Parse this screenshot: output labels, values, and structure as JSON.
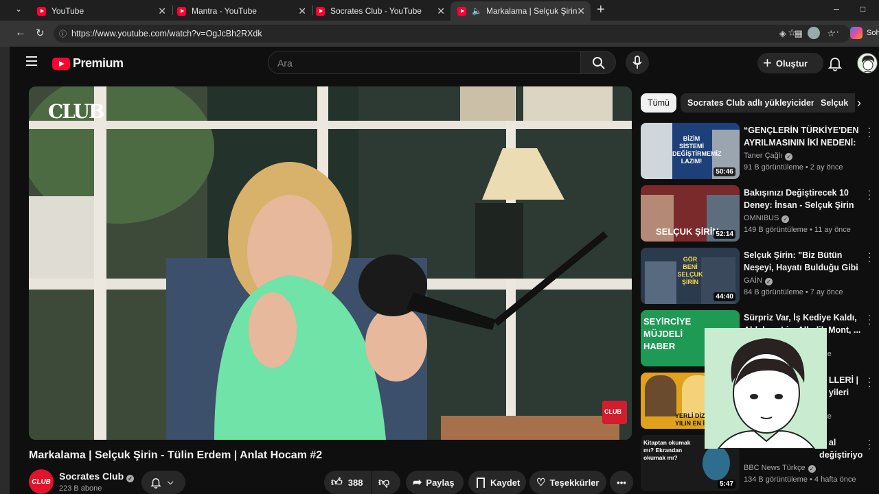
{
  "browser": {
    "tabs": [
      {
        "title": "YouTube",
        "active": false
      },
      {
        "title": "Mantra - YouTube",
        "active": false
      },
      {
        "title": "Socrates Club - YouTube",
        "active": false
      },
      {
        "title": "Markalama | Selçuk Şirin - Tülin",
        "active": true
      }
    ],
    "url": "https://www.youtube.com/watch?v=OgJcBh2RXdk",
    "copilot_label": "Soh"
  },
  "header": {
    "logo_text": "Premium",
    "search_placeholder": "Ara",
    "create_label": "Oluştur"
  },
  "video": {
    "title": "Markalama | Selçuk Şirin - Tülin Erdem | Anlat Hocam #2",
    "overlay_logo": "CLUB",
    "corner_logo": "CLUB",
    "channel": {
      "name": "Socrates Club",
      "avatar_text": "CLUB",
      "subscribers": "223 B abone"
    },
    "actions": {
      "likes": "388",
      "share": "Paylaş",
      "save": "Kaydet",
      "thanks": "Teşekkürler"
    }
  },
  "chips": [
    "Tümü",
    "Socrates Club adlı yükleyiciden",
    "Selçuk"
  ],
  "related": [
    {
      "title": "“GENÇLERİN TÜRKİYE'DEN AYRILMASININ İKİ NEDENİ: ...",
      "channel": "Taner Çağlı",
      "verified": true,
      "meta": "91 B görüntüleme • 2 ay önce",
      "duration": "50:46",
      "thumb_text": "BİZİM SİSTEMİ DEĞİŞTİRMEMİZ LAZIM!",
      "thumb_color": "#1d3f7a"
    },
    {
      "title": "Bakışınızı Değiştirecek 10 Deney: İnsan - Selçuk Şirin & ...",
      "channel": "OMNIBUS",
      "verified": true,
      "meta": "149 B görüntüleme • 11 ay önce",
      "duration": "52:14",
      "thumb_text": "SELÇUK ŞİRİN",
      "thumb_color": "#7a2a2a"
    },
    {
      "title": "Selçuk Şirin: \"Biz Bütün Neşeyi, Hayatı Bulduğu Gibi ...",
      "channel": "GAİN",
      "verified": true,
      "meta": "84 B görüntüleme • 7 ay önce",
      "duration": "44:40",
      "thumb_text": "GÖR BENİ SELÇUK ŞİRİN",
      "thumb_color": "#2b3a4d"
    },
    {
      "title": "Sürpriz Var, İş Kediye Kaldı, Ahlaksız Liç, Alkolik Mont, ...",
      "channel": "",
      "verified": false,
      "meta": "once",
      "duration": "",
      "thumb_text": "SEYİRCİYE MÜJDELİ HABER",
      "thumb_color": "#1f9a55"
    },
    {
      "title": "... LLERİ | ... yileri",
      "channel": "",
      "verified": false,
      "meta": "once",
      "duration": "",
      "thumb_text": "YERLİ DİZİ YILIN EN İYİ",
      "thumb_color": "#e0a21c"
    },
    {
      "title": "... al değiştiriyor?",
      "channel": "BBC News Türkçe",
      "verified": true,
      "meta": "134 B görüntüleme • 4 hafta önce",
      "duration": "5:47",
      "thumb_text": "Kitaptan okumak mı? Ekrandan okumak mı?",
      "thumb_color": "#1a1a1a"
    }
  ]
}
